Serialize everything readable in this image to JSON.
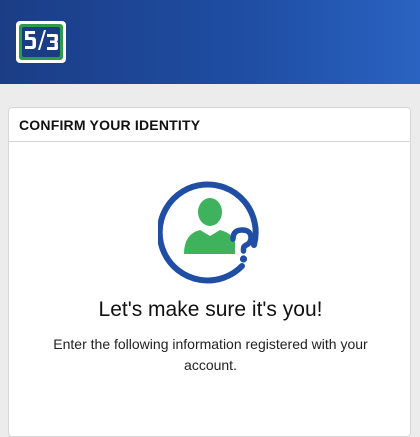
{
  "header": {
    "logo_icon": "fifth-third-bank-logo-icon",
    "colors": {
      "bar_dark": "#1b3d86",
      "bar_light": "#2a63c2",
      "logo_green": "#2b9c4b"
    }
  },
  "card": {
    "title": "CONFIRM YOUR IDENTITY",
    "icon": "user-question-icon",
    "headline": "Let's make sure it's you!",
    "description": "Enter the following information registered with your account.",
    "colors": {
      "circle": "#1f4ea4",
      "person": "#3eb25d"
    }
  }
}
